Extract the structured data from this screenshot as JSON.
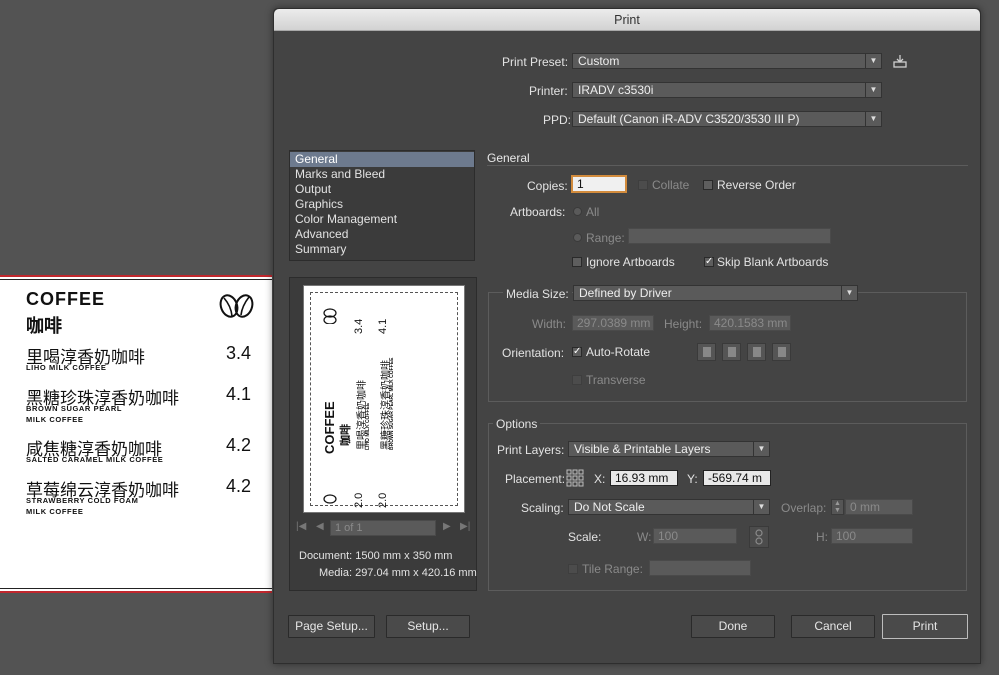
{
  "menu": {
    "title_en": "COFFEE",
    "title_zh": "咖啡",
    "items": [
      {
        "name": "里喝淳香奶咖啡",
        "sub": "LIHO MILK COFFEE",
        "price": "3.4"
      },
      {
        "name": "黑糖珍珠淳香奶咖啡",
        "sub": "BROWN SUGAR PEARL MILK COFFEE",
        "price": "4.1"
      },
      {
        "name": "咸焦糖淳香奶咖啡",
        "sub": "SALTED CARAMEL MILK COFFEE",
        "price": "4.2"
      },
      {
        "name": "草莓绵云淳香奶咖啡",
        "sub": "STRAWBERRY COLD FOAM MILK COFFEE",
        "price": "4.2"
      }
    ],
    "preview_prices": [
      "3.4",
      "4.1",
      "2.0",
      "2.0"
    ]
  },
  "dialog": {
    "title": "Print",
    "print_preset_label": "Print Preset:",
    "print_preset_value": "Custom",
    "printer_label": "Printer:",
    "printer_value": "IRADV c3530i",
    "ppd_label": "PPD:",
    "ppd_value": "Default (Canon iR-ADV C3520/3530 III P)",
    "categories": [
      "General",
      "Marks and Bleed",
      "Output",
      "Graphics",
      "Color Management",
      "Advanced",
      "Summary"
    ],
    "general_header": "General",
    "copies_label": "Copies:",
    "copies_value": "1",
    "collate_label": "Collate",
    "reverse_order_label": "Reverse Order",
    "artboards_label": "Artboards:",
    "all_label": "All",
    "range_label": "Range:",
    "ignore_artboards_label": "Ignore Artboards",
    "skip_blank_label": "Skip Blank Artboards",
    "media_size_label": "Media Size:",
    "media_size_value": "Defined by Driver",
    "width_label": "Width:",
    "width_value": "297.0389 mm",
    "height_label": "Height:",
    "height_value": "420.1583 mm",
    "orientation_label": "Orientation:",
    "auto_rotate_label": "Auto-Rotate",
    "transverse_label": "Transverse",
    "options_header": "Options",
    "print_layers_label": "Print Layers:",
    "print_layers_value": "Visible & Printable Layers",
    "placement_label": "Placement:",
    "x_label": "X:",
    "x_value": "16.93 mm",
    "y_label": "Y:",
    "y_value": "-569.74 m",
    "scaling_label": "Scaling:",
    "scaling_value": "Do Not Scale",
    "overlap_label": "Overlap:",
    "overlap_value": "0 mm",
    "scale_label": "Scale:",
    "w_label": "W:",
    "w_value": "100",
    "h_label": "H:",
    "h_value": "100",
    "tile_range_label": "Tile Range:",
    "page_nav": "1 of 1",
    "document_info": "Document: 1500 mm x 350 mm",
    "media_info": "Media: 297.04 mm x 420.16 mm",
    "page_setup_label": "Page Setup...",
    "setup_label": "Setup...",
    "done_label": "Done",
    "cancel_label": "Cancel",
    "print_label": "Print"
  }
}
